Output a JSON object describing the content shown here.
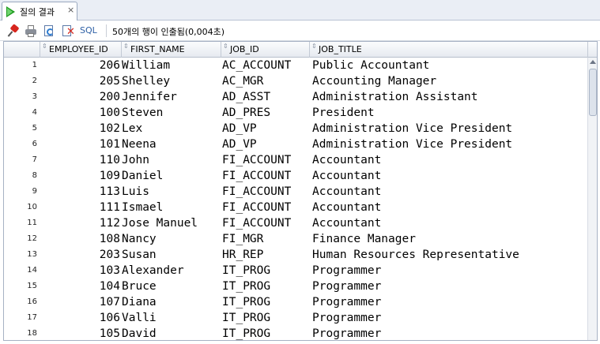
{
  "tab": {
    "title": "질의 결과",
    "close": "×"
  },
  "toolbar": {
    "sql_label": "SQL",
    "status": "50개의 행이 인출됨(0,004초)"
  },
  "grid": {
    "columns": [
      "EMPLOYEE_ID",
      "FIRST_NAME",
      "JOB_ID",
      "JOB_TITLE"
    ],
    "rows": [
      {
        "n": "1",
        "employee_id": "206",
        "first_name": "William",
        "job_id": "AC_ACCOUNT",
        "job_title": "Public Accountant"
      },
      {
        "n": "2",
        "employee_id": "205",
        "first_name": "Shelley",
        "job_id": "AC_MGR",
        "job_title": "Accounting Manager"
      },
      {
        "n": "3",
        "employee_id": "200",
        "first_name": "Jennifer",
        "job_id": "AD_ASST",
        "job_title": "Administration Assistant"
      },
      {
        "n": "4",
        "employee_id": "100",
        "first_name": "Steven",
        "job_id": "AD_PRES",
        "job_title": "President"
      },
      {
        "n": "5",
        "employee_id": "102",
        "first_name": "Lex",
        "job_id": "AD_VP",
        "job_title": "Administration Vice President"
      },
      {
        "n": "6",
        "employee_id": "101",
        "first_name": "Neena",
        "job_id": "AD_VP",
        "job_title": "Administration Vice President"
      },
      {
        "n": "7",
        "employee_id": "110",
        "first_name": "John",
        "job_id": "FI_ACCOUNT",
        "job_title": "Accountant"
      },
      {
        "n": "8",
        "employee_id": "109",
        "first_name": "Daniel",
        "job_id": "FI_ACCOUNT",
        "job_title": "Accountant"
      },
      {
        "n": "9",
        "employee_id": "113",
        "first_name": "Luis",
        "job_id": "FI_ACCOUNT",
        "job_title": "Accountant"
      },
      {
        "n": "10",
        "employee_id": "111",
        "first_name": "Ismael",
        "job_id": "FI_ACCOUNT",
        "job_title": "Accountant"
      },
      {
        "n": "11",
        "employee_id": "112",
        "first_name": "Jose Manuel",
        "job_id": "FI_ACCOUNT",
        "job_title": "Accountant"
      },
      {
        "n": "12",
        "employee_id": "108",
        "first_name": "Nancy",
        "job_id": "FI_MGR",
        "job_title": "Finance Manager"
      },
      {
        "n": "13",
        "employee_id": "203",
        "first_name": "Susan",
        "job_id": "HR_REP",
        "job_title": "Human Resources Representative"
      },
      {
        "n": "14",
        "employee_id": "103",
        "first_name": "Alexander",
        "job_id": "IT_PROG",
        "job_title": "Programmer"
      },
      {
        "n": "15",
        "employee_id": "104",
        "first_name": "Bruce",
        "job_id": "IT_PROG",
        "job_title": "Programmer"
      },
      {
        "n": "16",
        "employee_id": "107",
        "first_name": "Diana",
        "job_id": "IT_PROG",
        "job_title": "Programmer"
      },
      {
        "n": "17",
        "employee_id": "106",
        "first_name": "Valli",
        "job_id": "IT_PROG",
        "job_title": "Programmer"
      },
      {
        "n": "18",
        "employee_id": "105",
        "first_name": "David",
        "job_id": "IT_PROG",
        "job_title": "Programmer"
      }
    ]
  }
}
